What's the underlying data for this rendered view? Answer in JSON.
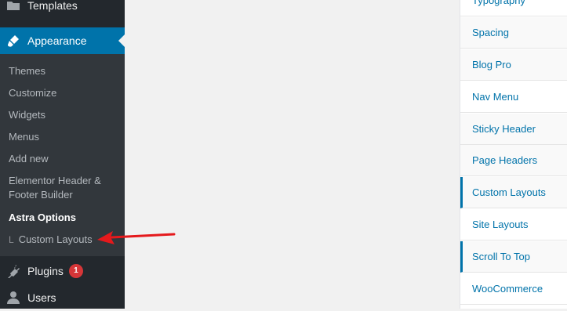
{
  "sidebar": {
    "templates": "Templates",
    "appearance": "Appearance",
    "submenu": {
      "themes": "Themes",
      "customize": "Customize",
      "widgets": "Widgets",
      "menus": "Menus",
      "add_new": "Add new",
      "elementor": "Elementor Header & Footer Builder",
      "astra_options": "Astra Options",
      "custom_layouts_prefix": "L",
      "custom_layouts": "Custom Layouts"
    },
    "plugins": "Plugins",
    "plugins_badge": "1",
    "users": "Users"
  },
  "panel": {
    "items": [
      "Typography",
      "Spacing",
      "Blog Pro",
      "Nav Menu",
      "Sticky Header",
      "Page Headers",
      "Custom Layouts",
      "Site Layouts",
      "Scroll To Top",
      "WooCommerce"
    ]
  },
  "colors": {
    "sidebar_bg": "#23282d",
    "submenu_bg": "#32373c",
    "active_bg": "#0073aa",
    "link": "#0073aa",
    "badge": "#d63638",
    "annotation_arrow": "#e5191c"
  },
  "icons": {
    "templates": "folder-icon",
    "appearance": "paintbrush-icon",
    "plugins": "plug-icon",
    "users": "user-icon"
  }
}
